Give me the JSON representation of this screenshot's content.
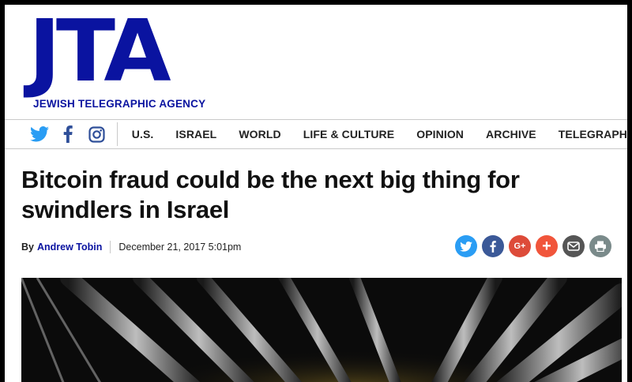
{
  "masthead": {
    "logo": "JTA",
    "tagline": "JEWISH TELEGRAPHIC AGENCY"
  },
  "social": [
    {
      "name": "twitter-icon",
      "color": "#2a9df4"
    },
    {
      "name": "facebook-icon",
      "color": "#2f4f99"
    },
    {
      "name": "instagram-icon",
      "color": "#2f4f99"
    }
  ],
  "nav": {
    "items": [
      {
        "label": "U.S."
      },
      {
        "label": "ISRAEL"
      },
      {
        "label": "WORLD"
      },
      {
        "label": "LIFE & CULTURE"
      },
      {
        "label": "OPINION"
      },
      {
        "label": "ARCHIVE"
      },
      {
        "label": "TELEGRAPH"
      }
    ]
  },
  "article": {
    "headline": "Bitcoin fraud could be the next big thing for swindlers in Israel",
    "by_prefix": "By",
    "author": "Andrew Tobin",
    "date": "December 21, 2017 5:01pm"
  },
  "share": [
    {
      "name": "share-twitter-icon",
      "color": "#2a9df4"
    },
    {
      "name": "share-facebook-icon",
      "color": "#3b5998"
    },
    {
      "name": "share-googleplus-icon",
      "color": "#dd4b39",
      "glyph": "G+"
    },
    {
      "name": "share-more-icon",
      "color": "#f1553b",
      "glyph": "+"
    },
    {
      "name": "share-email-icon",
      "color": "#555555"
    },
    {
      "name": "share-print-icon",
      "color": "#7a8a8a"
    }
  ],
  "colors": {
    "brand_blue": "#0a13a0",
    "text": "#111111",
    "rule": "#c9c9c9"
  }
}
